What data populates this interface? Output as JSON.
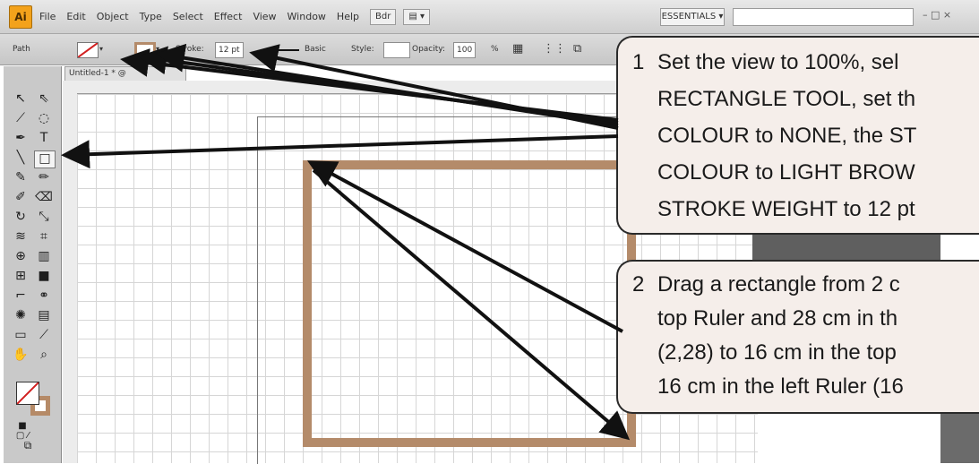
{
  "menubar": {
    "app_logo": "Ai",
    "menus": [
      "File",
      "Edit",
      "Object",
      "Type",
      "Select",
      "Effect",
      "View",
      "Window",
      "Help"
    ],
    "tool_buttons": [
      "Bdr",
      "▤ ▾"
    ],
    "workspace": "ESSENTIALS ▾",
    "window_controls": "– □ ×"
  },
  "controlbar": {
    "selection_label": "Path",
    "stroke_label": "Stroke:",
    "stroke_weight": "12 pt",
    "profile": "Basic",
    "style_label": "Style:",
    "opacity_label": "Opacity:",
    "opacity_value": "100",
    "percent": "%"
  },
  "document": {
    "tab_title": "Untitled-1 * @"
  },
  "colors": {
    "accent_stroke": "#b48b6a",
    "callout_bg": "#f5eeea"
  },
  "callouts": [
    {
      "number": "1",
      "lines": [
        "Set the view to 100%, sel",
        "RECTANGLE TOOL, set th",
        "COLOUR to NONE, the ST",
        "COLOUR to LIGHT BROW",
        "STROKE WEIGHT to 12 pt"
      ]
    },
    {
      "number": "2",
      "lines": [
        "Drag a rectangle from 2 c",
        "top Ruler and 28 cm in th",
        "(2,28) to 16 cm in the top",
        "16 cm in the left Ruler (16"
      ]
    }
  ]
}
